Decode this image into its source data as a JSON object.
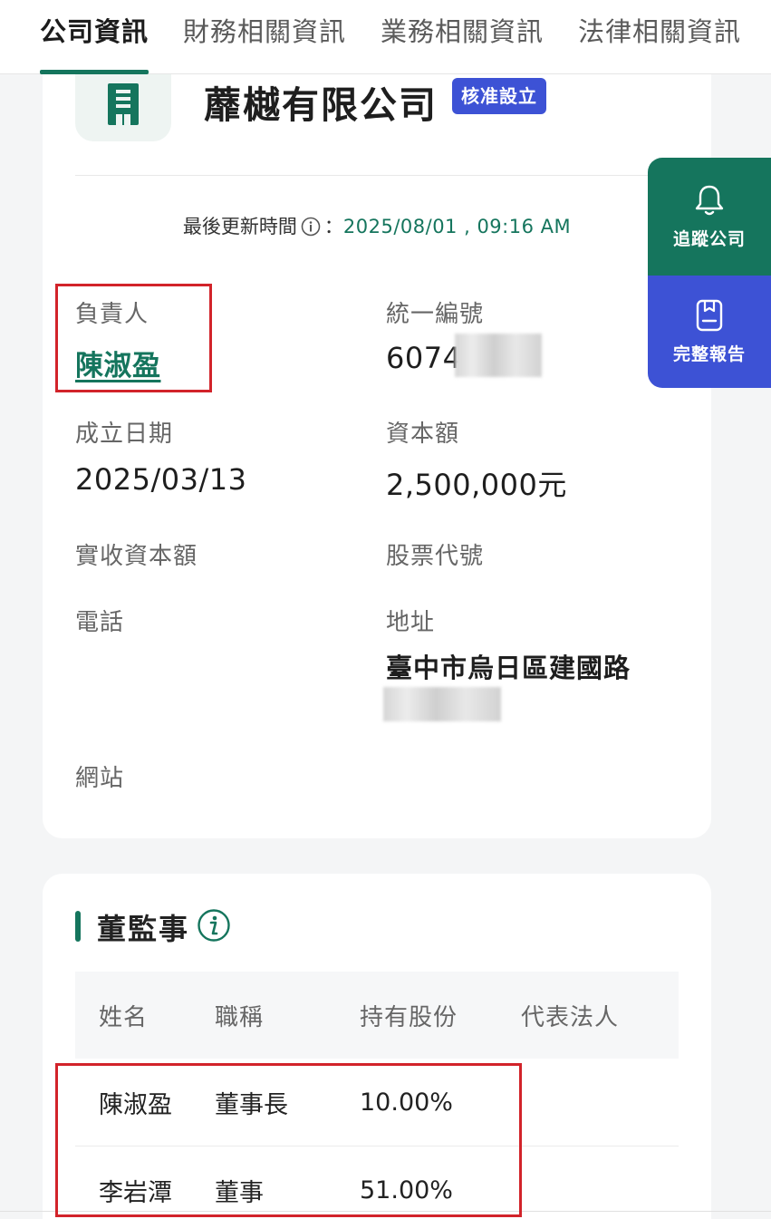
{
  "tabs": [
    {
      "label": "公司資訊",
      "active": true
    },
    {
      "label": "財務相關資訊",
      "active": false
    },
    {
      "label": "業務相關資訊",
      "active": false
    },
    {
      "label": "法律相關資訊",
      "active": false
    }
  ],
  "company": {
    "name": "蘼樾有限公司",
    "status": "核准設立",
    "logo_icon": "building-icon",
    "update_label": "最後更新時間",
    "update_sep": "：",
    "update_time": "2025/08/01 , 09:16 AM"
  },
  "fields": {
    "owner_label": "負責人",
    "owner_value": "陳淑盈",
    "tax_id_label": "統一編號",
    "tax_id_value": "6074",
    "founded_label": "成立日期",
    "founded_value": "2025/03/13",
    "capital_label": "資本額",
    "capital_value": "2,500,000元",
    "paid_capital_label": "實收資本額",
    "stock_code_label": "股票代號",
    "phone_label": "電話",
    "address_label": "地址",
    "address_value": "臺中市烏日區建國路",
    "website_label": "網站"
  },
  "directors": {
    "title": "董監事",
    "headers": [
      "姓名",
      "職稱",
      "持有股份",
      "代表法人"
    ],
    "rows": [
      {
        "name": "陳淑盈",
        "title": "董事長",
        "shares": "10.00%",
        "rep": ""
      },
      {
        "name": "李岩潭",
        "title": "董事",
        "shares": "51.00%",
        "rep": ""
      }
    ]
  },
  "side_actions": {
    "track_label": "追蹤公司",
    "report_label": "完整報告"
  },
  "colors": {
    "brand_green": "#15755d",
    "brand_blue": "#3d52d5",
    "annotation_red": "#d2232a"
  }
}
